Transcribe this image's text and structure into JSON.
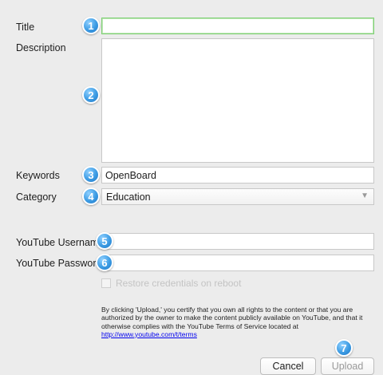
{
  "form": {
    "title_label": "Title",
    "title_value": "",
    "description_label": "Description",
    "description_value": "",
    "keywords_label": "Keywords",
    "keywords_value": "OpenBoard",
    "category_label": "Category",
    "category_value": "Education",
    "username_label": "YouTube Username",
    "username_value": "",
    "password_label": "YouTube Password",
    "password_value": "",
    "restore_label": "Restore credentials on reboot"
  },
  "terms": {
    "text": "By clicking 'Upload,' you certify that you own all rights to the content or that you are authorized by the owner to make the content publicly available on YouTube, and that it otherwise complies with the YouTube Terms of Service located at",
    "link": "http://www.youtube.com/t/terms"
  },
  "buttons": {
    "cancel": "Cancel",
    "upload": "Upload"
  },
  "badges": [
    "1",
    "2",
    "3",
    "4",
    "5",
    "6",
    "7"
  ],
  "colors": {
    "badge": "#3c9be3",
    "focus_border": "#7fcf74",
    "link": "#0000ee"
  }
}
